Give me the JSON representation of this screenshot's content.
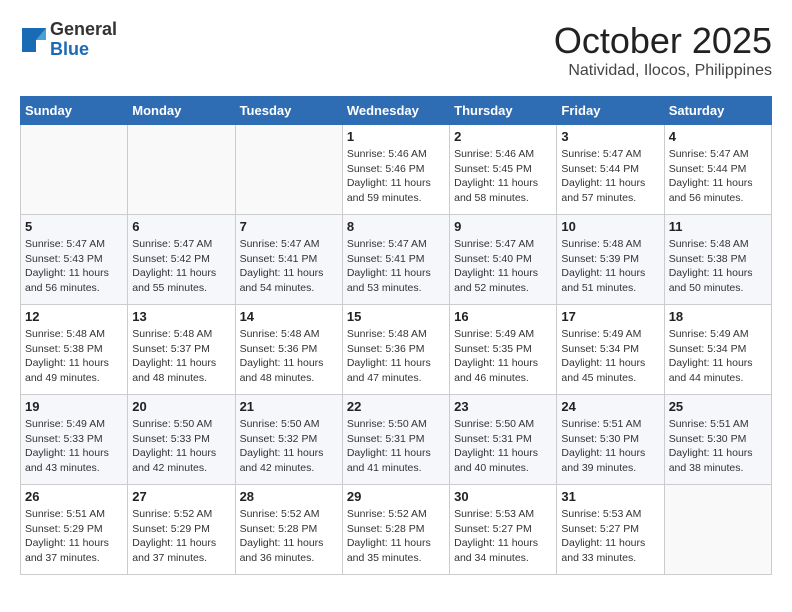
{
  "header": {
    "logo_general": "General",
    "logo_blue": "Blue",
    "month": "October 2025",
    "location": "Natividad, Ilocos, Philippines"
  },
  "weekdays": [
    "Sunday",
    "Monday",
    "Tuesday",
    "Wednesday",
    "Thursday",
    "Friday",
    "Saturday"
  ],
  "weeks": [
    [
      {
        "day": "",
        "info": ""
      },
      {
        "day": "",
        "info": ""
      },
      {
        "day": "",
        "info": ""
      },
      {
        "day": "1",
        "info": "Sunrise: 5:46 AM\nSunset: 5:46 PM\nDaylight: 11 hours and 59 minutes."
      },
      {
        "day": "2",
        "info": "Sunrise: 5:46 AM\nSunset: 5:45 PM\nDaylight: 11 hours and 58 minutes."
      },
      {
        "day": "3",
        "info": "Sunrise: 5:47 AM\nSunset: 5:44 PM\nDaylight: 11 hours and 57 minutes."
      },
      {
        "day": "4",
        "info": "Sunrise: 5:47 AM\nSunset: 5:44 PM\nDaylight: 11 hours and 56 minutes."
      }
    ],
    [
      {
        "day": "5",
        "info": "Sunrise: 5:47 AM\nSunset: 5:43 PM\nDaylight: 11 hours and 56 minutes."
      },
      {
        "day": "6",
        "info": "Sunrise: 5:47 AM\nSunset: 5:42 PM\nDaylight: 11 hours and 55 minutes."
      },
      {
        "day": "7",
        "info": "Sunrise: 5:47 AM\nSunset: 5:41 PM\nDaylight: 11 hours and 54 minutes."
      },
      {
        "day": "8",
        "info": "Sunrise: 5:47 AM\nSunset: 5:41 PM\nDaylight: 11 hours and 53 minutes."
      },
      {
        "day": "9",
        "info": "Sunrise: 5:47 AM\nSunset: 5:40 PM\nDaylight: 11 hours and 52 minutes."
      },
      {
        "day": "10",
        "info": "Sunrise: 5:48 AM\nSunset: 5:39 PM\nDaylight: 11 hours and 51 minutes."
      },
      {
        "day": "11",
        "info": "Sunrise: 5:48 AM\nSunset: 5:38 PM\nDaylight: 11 hours and 50 minutes."
      }
    ],
    [
      {
        "day": "12",
        "info": "Sunrise: 5:48 AM\nSunset: 5:38 PM\nDaylight: 11 hours and 49 minutes."
      },
      {
        "day": "13",
        "info": "Sunrise: 5:48 AM\nSunset: 5:37 PM\nDaylight: 11 hours and 48 minutes."
      },
      {
        "day": "14",
        "info": "Sunrise: 5:48 AM\nSunset: 5:36 PM\nDaylight: 11 hours and 48 minutes."
      },
      {
        "day": "15",
        "info": "Sunrise: 5:48 AM\nSunset: 5:36 PM\nDaylight: 11 hours and 47 minutes."
      },
      {
        "day": "16",
        "info": "Sunrise: 5:49 AM\nSunset: 5:35 PM\nDaylight: 11 hours and 46 minutes."
      },
      {
        "day": "17",
        "info": "Sunrise: 5:49 AM\nSunset: 5:34 PM\nDaylight: 11 hours and 45 minutes."
      },
      {
        "day": "18",
        "info": "Sunrise: 5:49 AM\nSunset: 5:34 PM\nDaylight: 11 hours and 44 minutes."
      }
    ],
    [
      {
        "day": "19",
        "info": "Sunrise: 5:49 AM\nSunset: 5:33 PM\nDaylight: 11 hours and 43 minutes."
      },
      {
        "day": "20",
        "info": "Sunrise: 5:50 AM\nSunset: 5:33 PM\nDaylight: 11 hours and 42 minutes."
      },
      {
        "day": "21",
        "info": "Sunrise: 5:50 AM\nSunset: 5:32 PM\nDaylight: 11 hours and 42 minutes."
      },
      {
        "day": "22",
        "info": "Sunrise: 5:50 AM\nSunset: 5:31 PM\nDaylight: 11 hours and 41 minutes."
      },
      {
        "day": "23",
        "info": "Sunrise: 5:50 AM\nSunset: 5:31 PM\nDaylight: 11 hours and 40 minutes."
      },
      {
        "day": "24",
        "info": "Sunrise: 5:51 AM\nSunset: 5:30 PM\nDaylight: 11 hours and 39 minutes."
      },
      {
        "day": "25",
        "info": "Sunrise: 5:51 AM\nSunset: 5:30 PM\nDaylight: 11 hours and 38 minutes."
      }
    ],
    [
      {
        "day": "26",
        "info": "Sunrise: 5:51 AM\nSunset: 5:29 PM\nDaylight: 11 hours and 37 minutes."
      },
      {
        "day": "27",
        "info": "Sunrise: 5:52 AM\nSunset: 5:29 PM\nDaylight: 11 hours and 37 minutes."
      },
      {
        "day": "28",
        "info": "Sunrise: 5:52 AM\nSunset: 5:28 PM\nDaylight: 11 hours and 36 minutes."
      },
      {
        "day": "29",
        "info": "Sunrise: 5:52 AM\nSunset: 5:28 PM\nDaylight: 11 hours and 35 minutes."
      },
      {
        "day": "30",
        "info": "Sunrise: 5:53 AM\nSunset: 5:27 PM\nDaylight: 11 hours and 34 minutes."
      },
      {
        "day": "31",
        "info": "Sunrise: 5:53 AM\nSunset: 5:27 PM\nDaylight: 11 hours and 33 minutes."
      },
      {
        "day": "",
        "info": ""
      }
    ]
  ]
}
